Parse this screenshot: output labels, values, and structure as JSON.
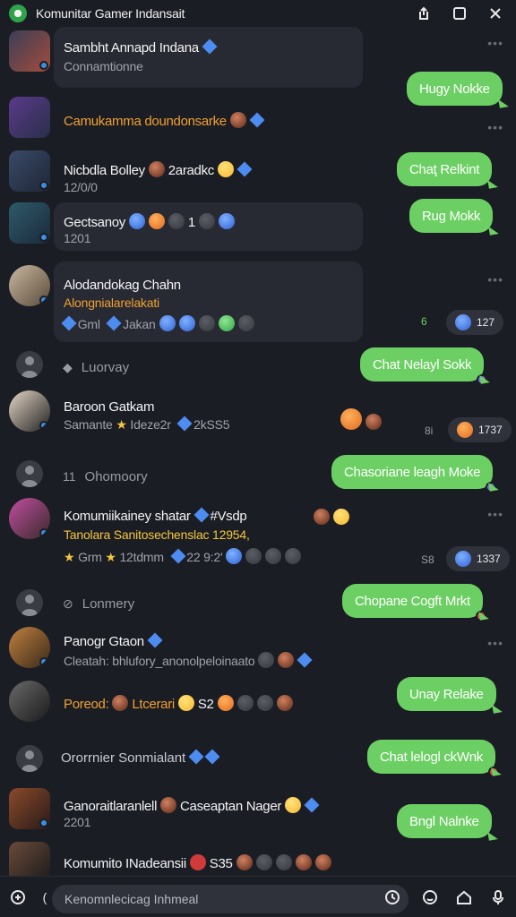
{
  "header": {
    "title": "Komunitar Gamer Indansait",
    "icons": [
      "share-icon",
      "square-icon",
      "close-icon"
    ]
  },
  "messages": [
    {
      "name": "Sambht Annapd Indana",
      "sub": "Connamtionne"
    },
    {
      "name": "Camukamma doundonsarke"
    },
    {
      "name": "Nicbdla Bolley",
      "name_suffix": "2aradkc",
      "sub": "12/0/0"
    },
    {
      "name": "Gectsanoy",
      "name_suffix": "1",
      "sub": "1201"
    },
    {
      "name": "Alodandokag Chahn",
      "sub": "Alongnialarelakati",
      "sub2": "Gml",
      "sub3": "Jakan"
    },
    {
      "system": "Luorvay"
    },
    {
      "name": "Baroon Gatkam",
      "sub": "Samante",
      "sub2": "Ideze2r",
      "sub3": "2kSS5"
    },
    {
      "system": "Ohomoory",
      "prefix": "11"
    },
    {
      "name": "Komumiikainey shatar",
      "name_suffix": "#Vsdp",
      "sub": "Tanolara Sanitosechenslac 12954,",
      "sub2": "Grm",
      "sub3": "12tdmm",
      "sub4": "22 9:2'"
    },
    {
      "system": "Lonmery"
    },
    {
      "name": "Panogr Gtaon",
      "sub": "Cleatah: bhlufory_anonolpeloinaato"
    },
    {
      "name": "Poreod:",
      "name_suffix": "Ltcerari",
      "num": "S2"
    },
    {
      "system": "Ororrnier Sonmialant"
    },
    {
      "name": "Ganoraitlaranlell",
      "name_suffix": "Caseaptan Nager",
      "sub": "2201"
    },
    {
      "name": "Komumito INadeansii",
      "name_suffix": "S35"
    }
  ],
  "outgoing": [
    "Hugy Nokke",
    "Chaţ Relkint",
    "Rug Mokk",
    "Chat Nelayl  Sokk",
    "Chasoriane leagh Moke",
    "Chopane Cogft Mrkt",
    "Unay Relake",
    "Chat lelogl ckWnk",
    "Bngl Nalnke"
  ],
  "reactions": [
    {
      "count": "6",
      "chip": "127"
    },
    {
      "count": "8i",
      "chip": "1737"
    },
    {
      "count": "S8",
      "chip": "1337"
    }
  ],
  "composer": {
    "placeholder": "Kenomnlecicag Inhmeal"
  }
}
